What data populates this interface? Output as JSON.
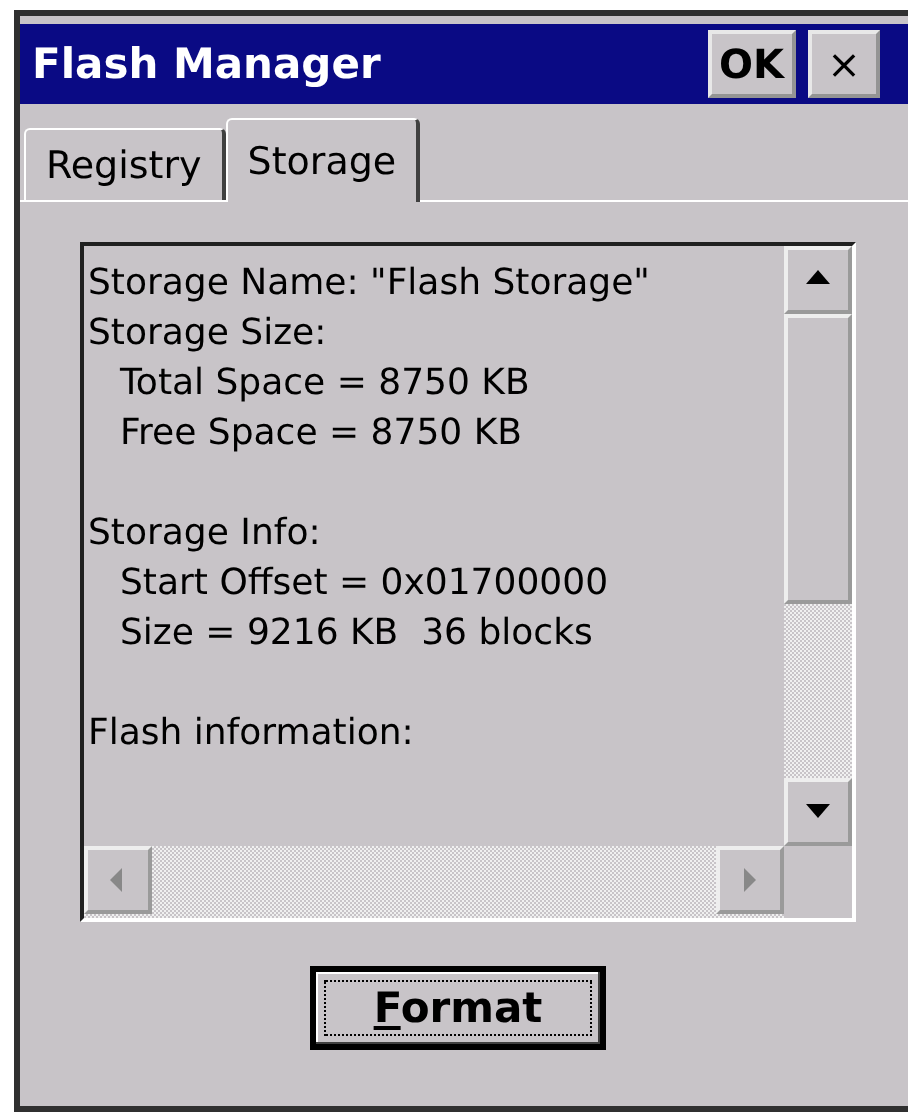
{
  "window": {
    "title": "Flash Manager",
    "ok_button": "OK",
    "close_button": "×"
  },
  "tabs": [
    {
      "label": "Registry",
      "selected": false
    },
    {
      "label": "Storage",
      "selected": true
    }
  ],
  "info_lines": [
    {
      "text": "Storage Name: \"Flash Storage\"",
      "indented": false,
      "gap_before": false
    },
    {
      "text": "Storage Size:",
      "indented": false,
      "gap_before": false
    },
    {
      "text": "Total Space = 8750 KB",
      "indented": true,
      "gap_before": false
    },
    {
      "text": "Free Space = 8750 KB",
      "indented": true,
      "gap_before": false
    },
    {
      "text": "Storage Info:",
      "indented": false,
      "gap_before": true
    },
    {
      "text": "Start Offset = 0x01700000",
      "indented": true,
      "gap_before": false
    },
    {
      "text": "Size = 9216 KB  36 blocks",
      "indented": true,
      "gap_before": false
    },
    {
      "text": "Flash information:",
      "indented": false,
      "gap_before": true
    }
  ],
  "format_button": "Format"
}
